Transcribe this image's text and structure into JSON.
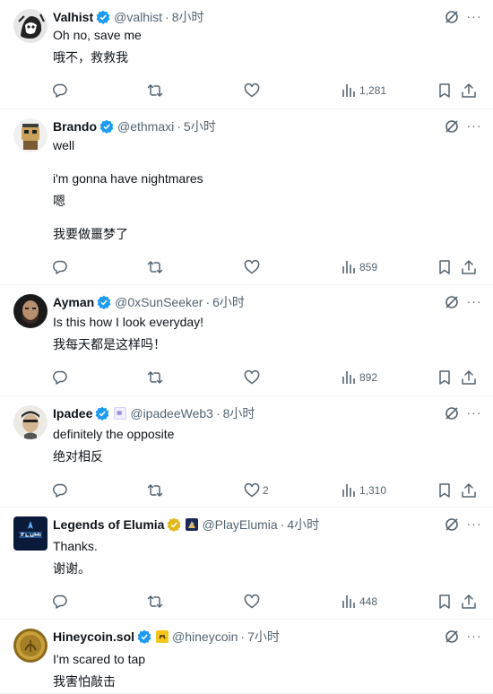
{
  "tweets": [
    {
      "name": "Valhist",
      "handle": "@valhist",
      "time": "8小时",
      "lines": [
        "Oh no, save me",
        "哦不，救救我"
      ],
      "likes": "",
      "views": "1,281"
    },
    {
      "name": "Brando",
      "handle": "@ethmaxi",
      "time": "5小时",
      "lines": [
        "well",
        "i'm gonna have nightmares",
        "嗯",
        "我要做噩梦了"
      ],
      "likes": "",
      "views": "859"
    },
    {
      "name": "Ayman",
      "handle": "@0xSunSeeker",
      "time": "6小时",
      "lines": [
        "Is this how I look everyday!",
        "我每天都是这样吗！"
      ],
      "likes": "",
      "views": "892"
    },
    {
      "name": "Ipadee",
      "handle": "@ipadeeWeb3",
      "time": "8小时",
      "lines": [
        "definitely the opposite",
        "绝对相反"
      ],
      "likes": "2",
      "views": "1,310"
    },
    {
      "name": "Legends of Elumia",
      "handle": "@PlayElumia",
      "time": "4小时",
      "lines": [
        "Thanks.",
        "谢谢。"
      ],
      "likes": "",
      "views": "448"
    },
    {
      "name": "Hineycoin.sol",
      "handle": "@hineycoin",
      "time": "7小时",
      "lines": [
        "I'm scared to tap",
        "我害怕敲击"
      ],
      "likes": "",
      "views": ""
    }
  ],
  "separator": "·",
  "more_label": "···",
  "colors": {
    "verified_blue": "#1d9bf0",
    "verified_gold": "#e2b719",
    "text_primary": "#0f1419",
    "text_secondary": "#536471",
    "divider": "#eff3f4"
  },
  "icons": {
    "reply": "reply-icon",
    "retweet": "retweet-icon",
    "like": "like-icon",
    "views": "views-icon",
    "bookmark": "bookmark-icon",
    "share": "share-icon",
    "grok": "grok-icon",
    "more": "more-icon"
  }
}
